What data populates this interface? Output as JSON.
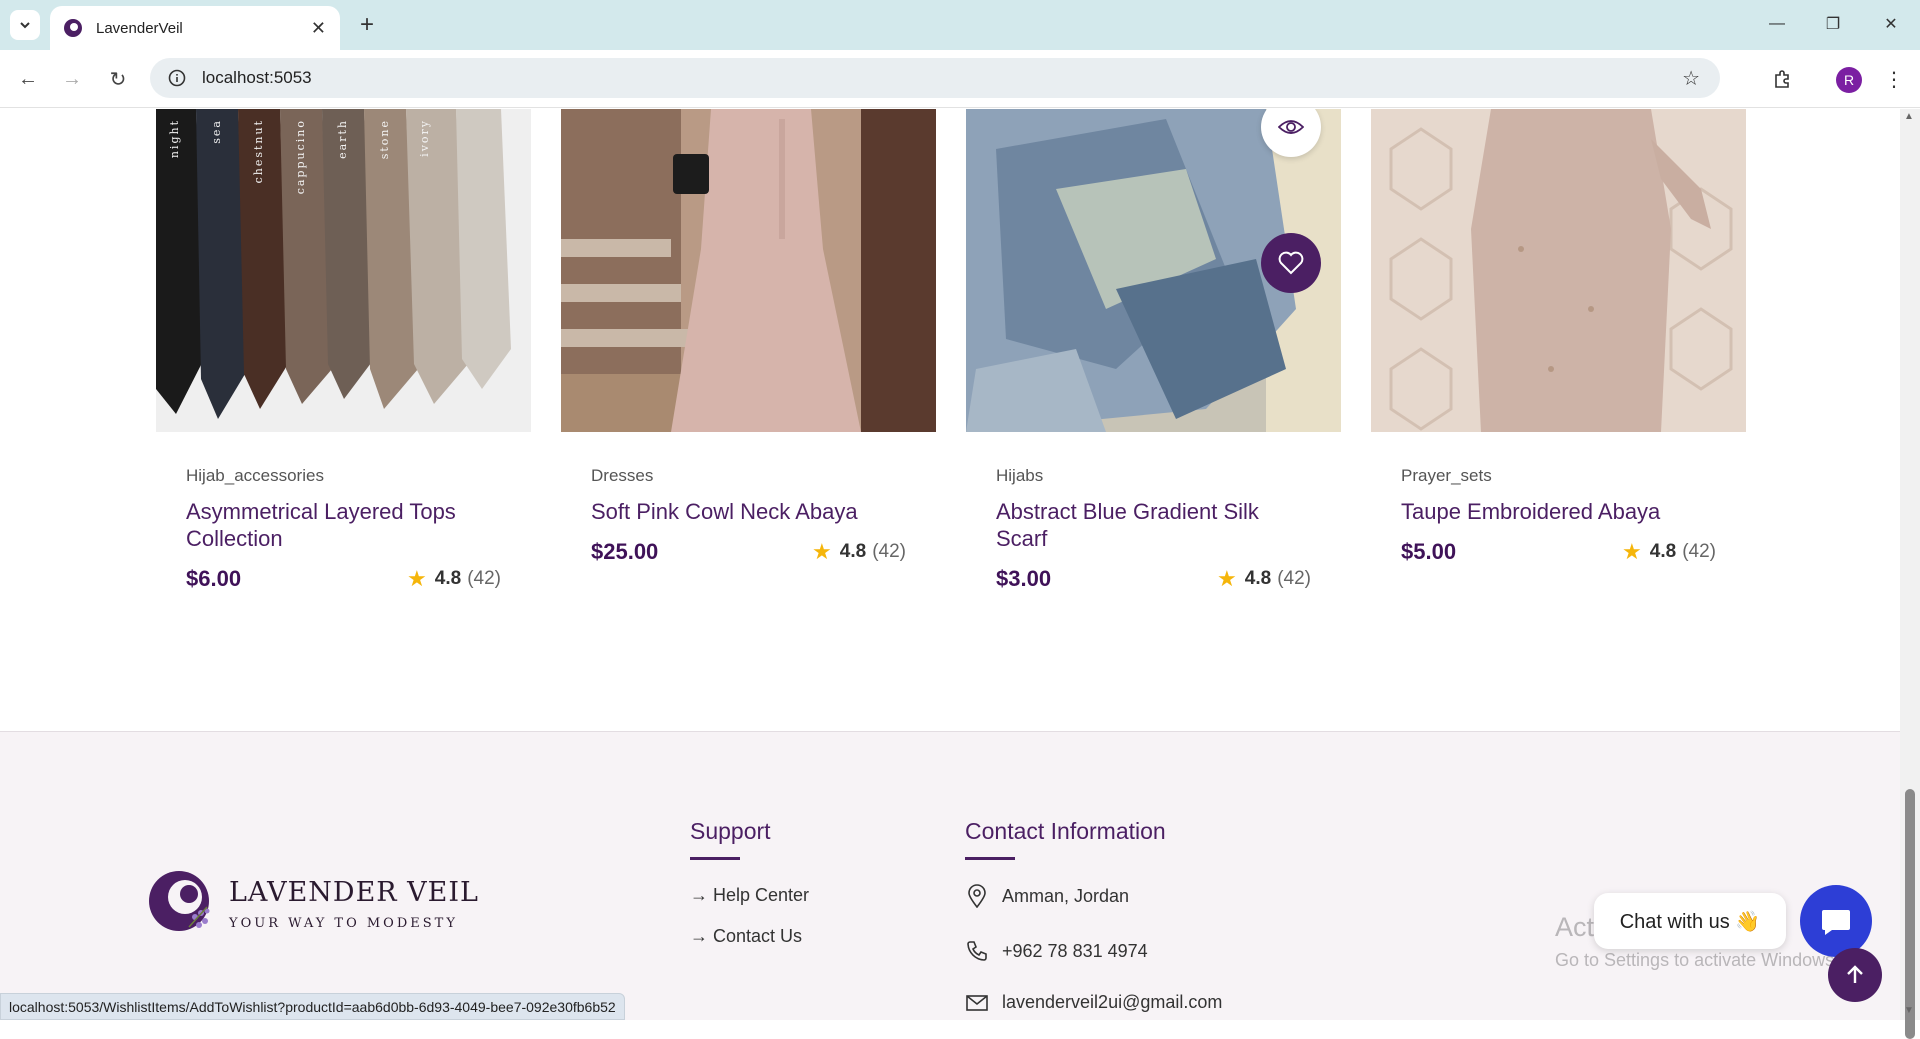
{
  "browser": {
    "tab_title": "LavenderVeil",
    "url": "localhost:5053",
    "profile_initial": "R",
    "status_url": "localhost:5053/WishlistItems/AddToWishlist?productId=aab6d0bb-6d93-4049-bee7-092e30fb6b52"
  },
  "products": [
    {
      "category": "Hijab_accessories",
      "name": "Asymmetrical Layered Tops Collection",
      "price": "$6.00",
      "rating": "4.8",
      "reviews": "(42)"
    },
    {
      "category": "Dresses",
      "name": "Soft Pink Cowl Neck Abaya",
      "price": "$25.00",
      "rating": "4.8",
      "reviews": "(42)"
    },
    {
      "category": "Hijabs",
      "name": "Abstract Blue Gradient Silk Scarf",
      "price": "$3.00",
      "rating": "4.8",
      "reviews": "(42)"
    },
    {
      "category": "Prayer_sets",
      "name": "Taupe Embroidered Abaya",
      "price": "$5.00",
      "rating": "4.8",
      "reviews": "(42)"
    }
  ],
  "hijab_color_labels": [
    "night",
    "sea",
    "chestnut",
    "cappucino",
    "earth",
    "stone",
    "ivory"
  ],
  "footer": {
    "logo_title": "LAVENDER VEIL",
    "logo_tagline": "YOUR WAY TO MODESTY",
    "support_title": "Support",
    "support_links": [
      "→ Help Center",
      "→ Contact Us"
    ],
    "contact_title": "Contact Information",
    "address": "Amman, Jordan",
    "phone": "+962 78 831 4974",
    "email": "lavenderveil2ui@gmail.com"
  },
  "chat": {
    "label": "Chat with us 👋"
  },
  "watermark": {
    "line1": "Activate Windows",
    "line2": "Go to Settings to activate Windows."
  },
  "colors": {
    "brand": "#4b1f63",
    "star": "#f5b50a",
    "chat": "#2d3ed6"
  }
}
